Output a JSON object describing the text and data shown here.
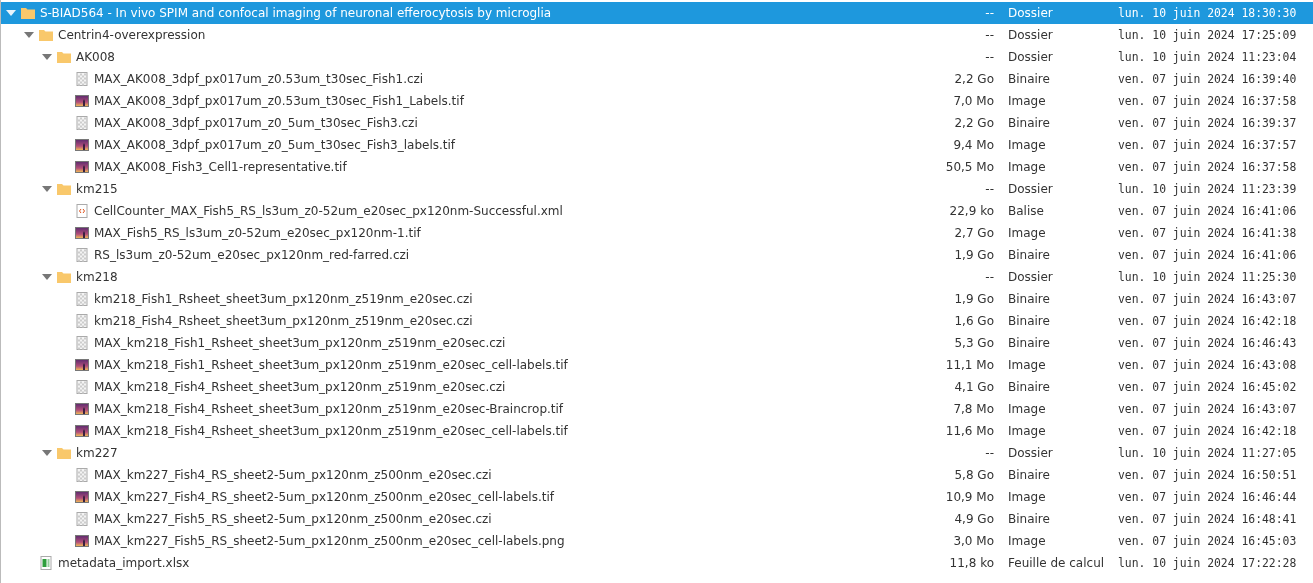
{
  "tree": [
    {
      "kind": "folder",
      "name": "S-BIAD564 - In vivo SPIM and confocal imaging of neuronal efferocytosis by microglia",
      "size": "--",
      "type": "Dossier",
      "date": "lun. 10 juin 2024 18:30:30",
      "expanded": true,
      "selected": true,
      "children": [
        {
          "kind": "folder",
          "name": "Centrin4-overexpression",
          "size": "--",
          "type": "Dossier",
          "date": "lun. 10 juin 2024 17:25:09",
          "expanded": true,
          "selected": false,
          "children": [
            {
              "kind": "folder",
              "name": "AK008",
              "size": "--",
              "type": "Dossier",
              "date": "lun. 10 juin 2024 11:23:04",
              "expanded": true,
              "selected": false,
              "children": [
                {
                  "kind": "binary",
                  "name": "MAX_AK008_3dpf_px017um_z0.53um_t30sec_Fish1.czi",
                  "size": "2,2 Go",
                  "type": "Binaire",
                  "date": "ven. 07 juin 2024 16:39:40",
                  "selected": false
                },
                {
                  "kind": "image",
                  "name": "MAX_AK008_3dpf_px017um_z0.53um_t30sec_Fish1_Labels.tif",
                  "size": "7,0 Mo",
                  "type": "Image",
                  "date": "ven. 07 juin 2024 16:37:58",
                  "selected": false
                },
                {
                  "kind": "binary",
                  "name": "MAX_AK008_3dpf_px017um_z0_5um_t30sec_Fish3.czi",
                  "size": "2,2 Go",
                  "type": "Binaire",
                  "date": "ven. 07 juin 2024 16:39:37",
                  "selected": false
                },
                {
                  "kind": "image",
                  "name": "MAX_AK008_3dpf_px017um_z0_5um_t30sec_Fish3_labels.tif",
                  "size": "9,4 Mo",
                  "type": "Image",
                  "date": "ven. 07 juin 2024 16:37:57",
                  "selected": false
                },
                {
                  "kind": "image",
                  "name": "MAX_AK008_Fish3_Cell1-representative.tif",
                  "size": "50,5 Mo",
                  "type": "Image",
                  "date": "ven. 07 juin 2024 16:37:58",
                  "selected": false
                }
              ]
            },
            {
              "kind": "folder",
              "name": "km215",
              "size": "--",
              "type": "Dossier",
              "date": "lun. 10 juin 2024 11:23:39",
              "expanded": true,
              "selected": false,
              "children": [
                {
                  "kind": "xml",
                  "name": "CellCounter_MAX_Fish5_RS_ls3um_z0-52um_e20sec_px120nm-Successful.xml",
                  "size": "22,9 ko",
                  "type": "Balise",
                  "date": "ven. 07 juin 2024 16:41:06",
                  "selected": false
                },
                {
                  "kind": "image",
                  "name": "MAX_Fish5_RS_ls3um_z0-52um_e20sec_px120nm-1.tif",
                  "size": "2,7 Go",
                  "type": "Image",
                  "date": "ven. 07 juin 2024 16:41:38",
                  "selected": false
                },
                {
                  "kind": "binary",
                  "name": "RS_ls3um_z0-52um_e20sec_px120nm_red-farred.czi",
                  "size": "1,9 Go",
                  "type": "Binaire",
                  "date": "ven. 07 juin 2024 16:41:06",
                  "selected": false
                }
              ]
            },
            {
              "kind": "folder",
              "name": "km218",
              "size": "--",
              "type": "Dossier",
              "date": "lun. 10 juin 2024 11:25:30",
              "expanded": true,
              "selected": false,
              "children": [
                {
                  "kind": "binary",
                  "name": "km218_Fish1_Rsheet_sheet3um_px120nm_z519nm_e20sec.czi",
                  "size": "1,9 Go",
                  "type": "Binaire",
                  "date": "ven. 07 juin 2024 16:43:07",
                  "selected": false
                },
                {
                  "kind": "binary",
                  "name": "km218_Fish4_Rsheet_sheet3um_px120nm_z519nm_e20sec.czi",
                  "size": "1,6 Go",
                  "type": "Binaire",
                  "date": "ven. 07 juin 2024 16:42:18",
                  "selected": false
                },
                {
                  "kind": "binary",
                  "name": "MAX_km218_Fish1_Rsheet_sheet3um_px120nm_z519nm_e20sec.czi",
                  "size": "5,3 Go",
                  "type": "Binaire",
                  "date": "ven. 07 juin 2024 16:46:43",
                  "selected": false
                },
                {
                  "kind": "image",
                  "name": "MAX_km218_Fish1_Rsheet_sheet3um_px120nm_z519nm_e20sec_cell-labels.tif",
                  "size": "11,1 Mo",
                  "type": "Image",
                  "date": "ven. 07 juin 2024 16:43:08",
                  "selected": false
                },
                {
                  "kind": "binary",
                  "name": "MAX_km218_Fish4_Rsheet_sheet3um_px120nm_z519nm_e20sec.czi",
                  "size": "4,1 Go",
                  "type": "Binaire",
                  "date": "ven. 07 juin 2024 16:45:02",
                  "selected": false
                },
                {
                  "kind": "image",
                  "name": "MAX_km218_Fish4_Rsheet_sheet3um_px120nm_z519nm_e20sec-Braincrop.tif",
                  "size": "7,8 Mo",
                  "type": "Image",
                  "date": "ven. 07 juin 2024 16:43:07",
                  "selected": false
                },
                {
                  "kind": "image",
                  "name": "MAX_km218_Fish4_Rsheet_sheet3um_px120nm_z519nm_e20sec_cell-labels.tif",
                  "size": "11,6 Mo",
                  "type": "Image",
                  "date": "ven. 07 juin 2024 16:42:18",
                  "selected": false
                }
              ]
            },
            {
              "kind": "folder",
              "name": "km227",
              "size": "--",
              "type": "Dossier",
              "date": "lun. 10 juin 2024 11:27:05",
              "expanded": true,
              "selected": false,
              "children": [
                {
                  "kind": "binary",
                  "name": "MAX_km227_Fish4_RS_sheet2-5um_px120nm_z500nm_e20sec.czi",
                  "size": "5,8 Go",
                  "type": "Binaire",
                  "date": "ven. 07 juin 2024 16:50:51",
                  "selected": false
                },
                {
                  "kind": "image",
                  "name": "MAX_km227_Fish4_RS_sheet2-5um_px120nm_z500nm_e20sec_cell-labels.tif",
                  "size": "10,9 Mo",
                  "type": "Image",
                  "date": "ven. 07 juin 2024 16:46:44",
                  "selected": false
                },
                {
                  "kind": "binary",
                  "name": "MAX_km227_Fish5_RS_sheet2-5um_px120nm_z500nm_e20sec.czi",
                  "size": "4,9 Go",
                  "type": "Binaire",
                  "date": "ven. 07 juin 2024 16:48:41",
                  "selected": false
                },
                {
                  "kind": "image",
                  "name": "MAX_km227_Fish5_RS_sheet2-5um_px120nm_z500nm_e20sec_cell-labels.png",
                  "size": "3,0 Mo",
                  "type": "Image",
                  "date": "ven. 07 juin 2024 16:45:03",
                  "selected": false
                }
              ]
            }
          ]
        },
        {
          "kind": "spreadsheet",
          "name": "metadata_import.xlsx",
          "size": "11,8 ko",
          "type": "Feuille de calcul",
          "date": "lun. 10 juin 2024 17:22:28",
          "selected": false
        }
      ]
    }
  ]
}
